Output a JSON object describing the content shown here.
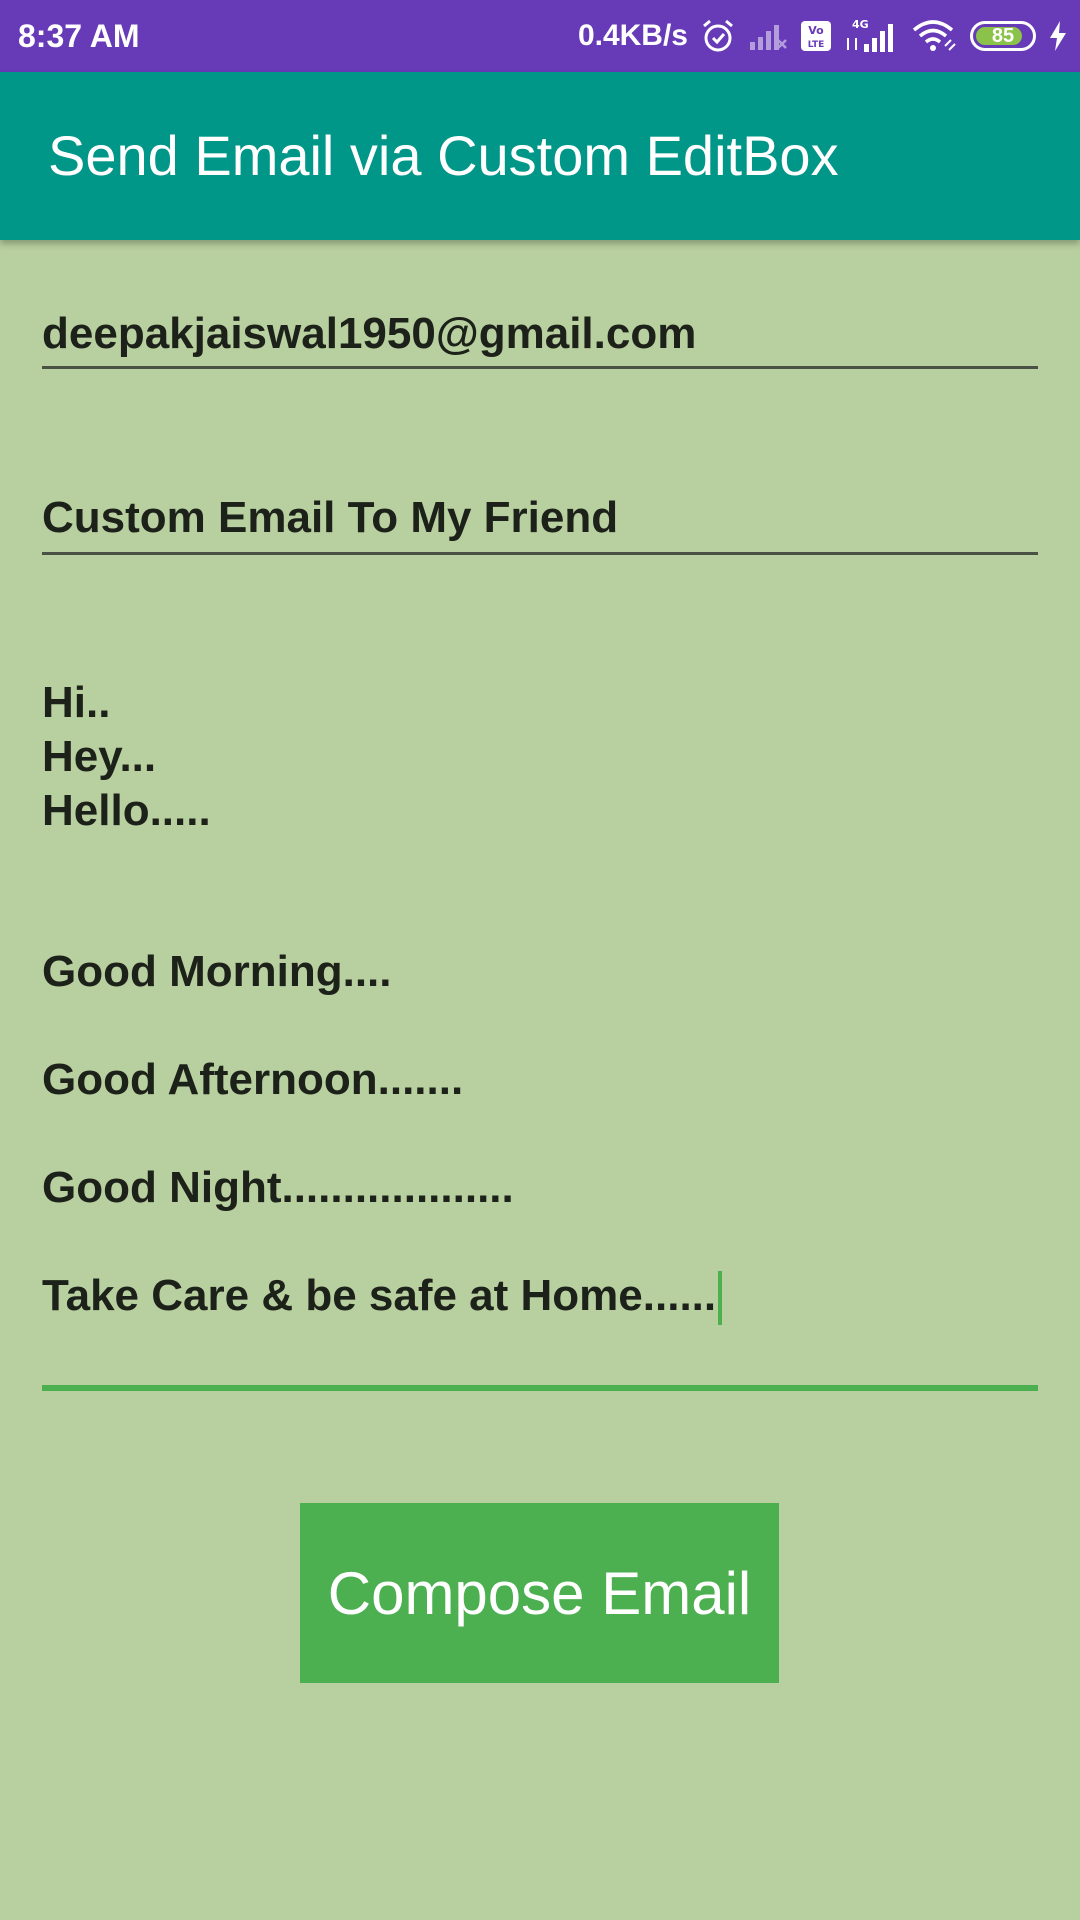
{
  "status_bar": {
    "time": "8:37 AM",
    "net_speed": "0.4KB/s",
    "battery_level": "85",
    "battery_fraction": 0.85,
    "icons": [
      "alarm-icon",
      "mobile-signal-1-icon",
      "volte-icon",
      "4g-signal-icon",
      "wifi-icon",
      "battery-icon",
      "charging-icon"
    ],
    "colors": {
      "background": "#673ab7",
      "battery_fill": "#8bc34a"
    }
  },
  "app_bar": {
    "title": "Send Email via Custom EditBox",
    "color": "#009688"
  },
  "form": {
    "to_value": "deepakjaiswal1950@gmail.com",
    "subject_value": "Custom Email To My Friend",
    "message_lines": {
      "hi": "Hi..",
      "hey": "Hey...",
      "hello": "Hello.....",
      "good_morning": "Good Morning....",
      "good_afternoon": "Good Afternoon.......",
      "good_night": "Good Night...................",
      "take_care": "Take Care & be safe at Home......"
    },
    "accent_color": "#4caf50",
    "background_color": "#b8cf9f"
  },
  "compose_button": {
    "label": "Compose Email"
  }
}
